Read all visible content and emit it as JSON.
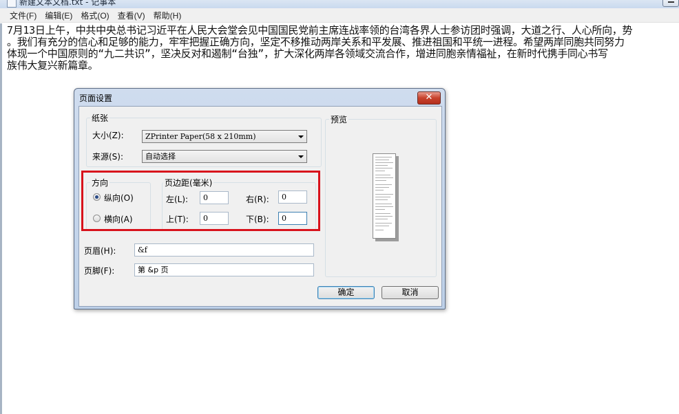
{
  "window": {
    "title": "新建文本文档.txt - 记事本"
  },
  "menubar": {
    "items": [
      "文件(F)",
      "编辑(E)",
      "格式(O)",
      "查看(V)",
      "帮助(H)"
    ]
  },
  "editor": {
    "lines": [
      "7月13日上午，中共中央总书记习近平在人民大会堂会见中国国民党前主席连战率领的台湾各界人士参访团时强调，大道之行、人心所向，势",
      "。我们有充分的信心和足够的能力，牢牢把握正确方向，坚定不移推动两岸关系和平发展、推进祖国和平统一进程。希望两岸同胞共同努力",
      "体现一个中国原则的“九二共识”，坚决反对和遏制“台独”，扩大深化两岸各领域交流合作，增进同胞亲情福祉，在新时代携手同心书写",
      "族伟大复兴新篇章。"
    ]
  },
  "dialog": {
    "title": "页面设置",
    "close_glyph": "✕",
    "paper_group": "纸张",
    "size_label": "大小(Z):",
    "size_value": "ZPrinter Paper(58 x 210mm)",
    "source_label": "来源(S):",
    "source_value": "自动选择",
    "orientation_group": "方向",
    "portrait_label": "纵向(O)",
    "landscape_label": "横向(A)",
    "orientation_selected": "portrait",
    "margins_group": "页边距(毫米)",
    "left_label": "左(L):",
    "left_value": "0",
    "right_label": "右(R):",
    "right_value": "0",
    "top_label": "上(T):",
    "top_value": "0",
    "bottom_label": "下(B):",
    "bottom_value": "0",
    "header_label": "页眉(H):",
    "header_value": "&f",
    "footer_label": "页脚(F):",
    "footer_value": "第 &p 页",
    "preview_group": "预览",
    "ok_label": "确定",
    "cancel_label": "取消",
    "highlight_color": "#d8121b"
  }
}
